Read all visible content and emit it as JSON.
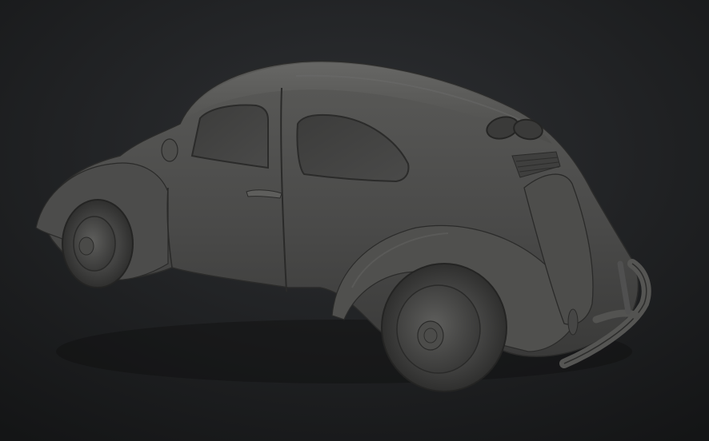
{
  "viewport": {
    "background_top": "#2b2d30",
    "background_bottom": "#141516"
  },
  "model": {
    "subject": "vw-beetle-sculpt",
    "base_color": "#4a4a49",
    "shadow_color": "#2e2e2e",
    "highlight_color": "#6b6b69"
  }
}
